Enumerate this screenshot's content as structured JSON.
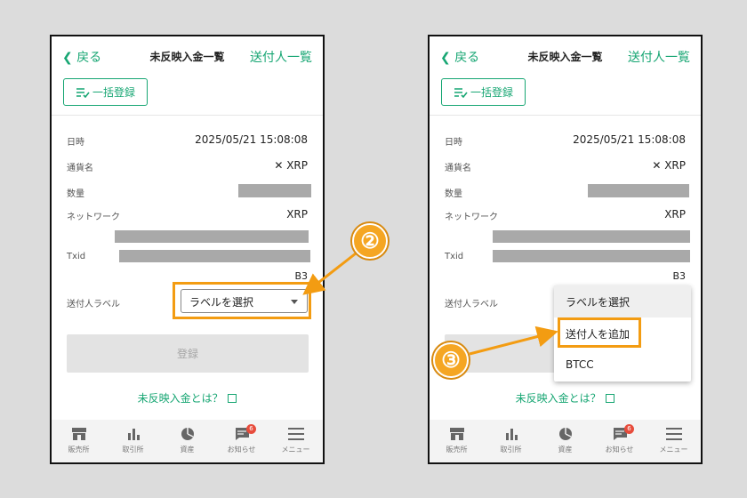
{
  "header": {
    "back_label": "戻る",
    "title": "未反映入金一覧",
    "senders_link": "送付人一覧"
  },
  "bulk_button": {
    "label": "一括登録"
  },
  "details": {
    "datetime_label": "日時",
    "datetime_value": "2025/05/21 15:08:08",
    "currency_label": "通貨名",
    "currency_value": "XRP",
    "amount_label": "数量",
    "network_label": "ネットワーク",
    "network_value": "XRP",
    "txid_label": "Txid",
    "txid_suffix": "B3"
  },
  "sender_label": {
    "label": "送付人ラベル",
    "select_placeholder": "ラベルを選択",
    "options": [
      "ラベルを選択",
      "送付人を追加",
      "BTCC"
    ]
  },
  "submit_label": "登録",
  "about_link": "未反映入金とは？",
  "tabbar": {
    "items": [
      {
        "label": "販売所",
        "icon": "store-icon"
      },
      {
        "label": "取引所",
        "icon": "bar-chart-icon"
      },
      {
        "label": "資産",
        "icon": "pie-chart-icon"
      },
      {
        "label": "お知らせ",
        "icon": "message-icon",
        "badge": "6"
      },
      {
        "label": "メニュー",
        "icon": "menu-icon"
      }
    ]
  },
  "annotations": {
    "step2": "②",
    "step3": "③"
  },
  "colors": {
    "accent": "#17a673",
    "highlight": "#f39c12",
    "badge": "#e74c3c",
    "redaction": "#a9a9a9"
  }
}
